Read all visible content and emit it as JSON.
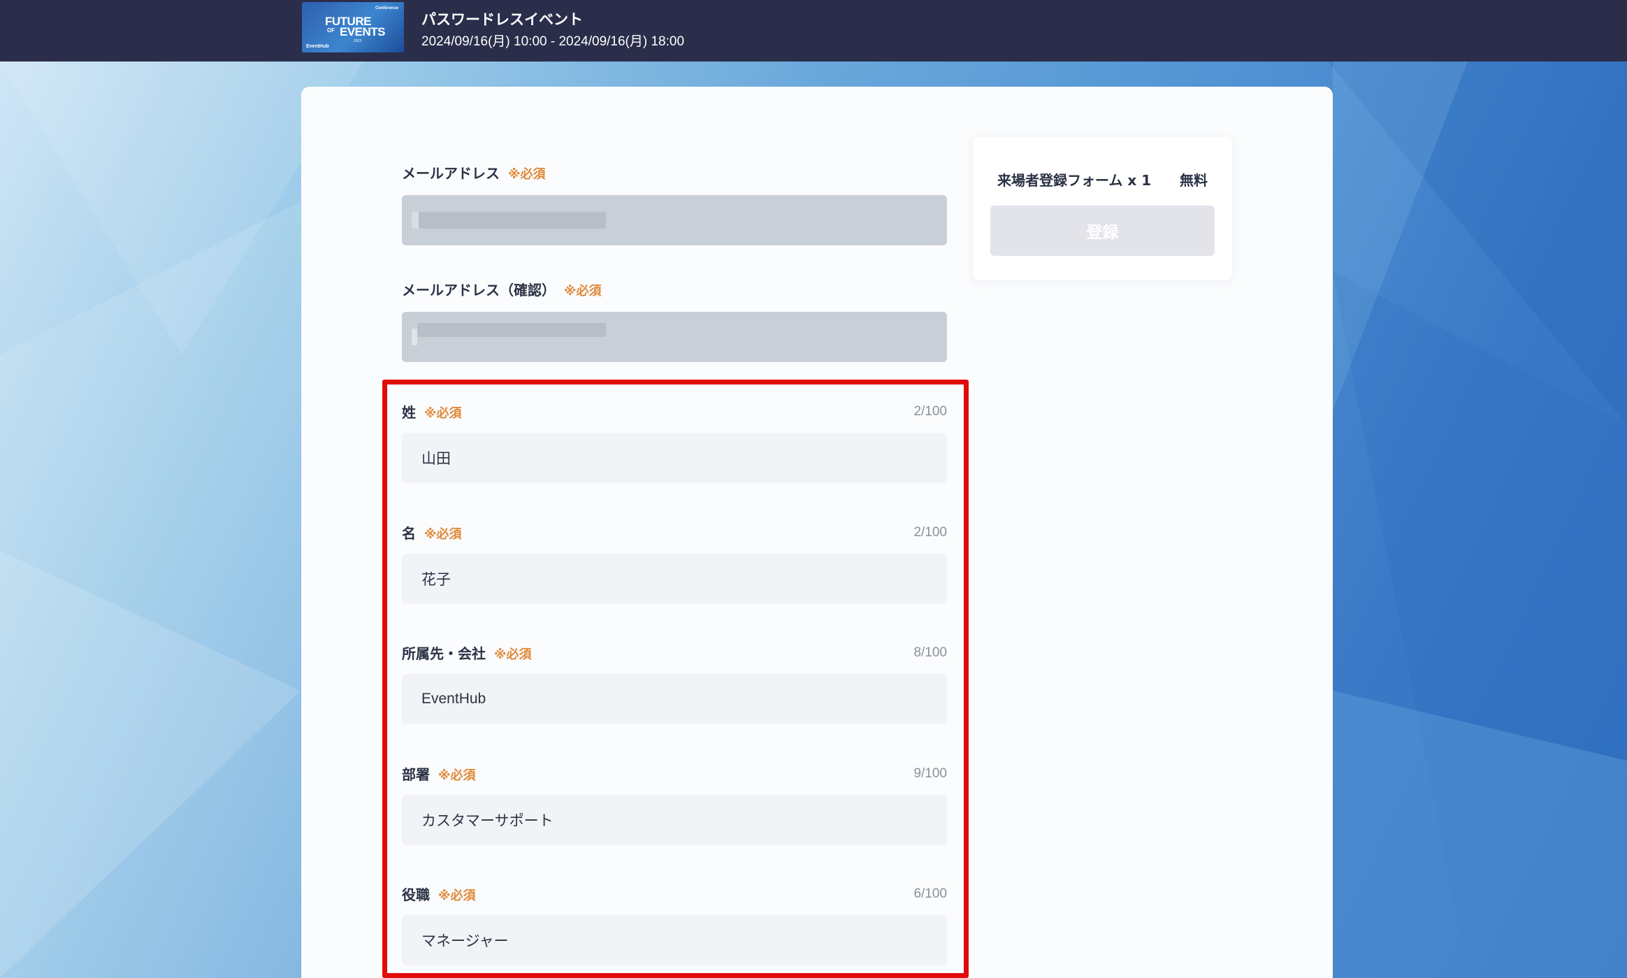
{
  "header": {
    "logo": {
      "small_text": "Conference",
      "line1": "FUTURE",
      "of": "OF",
      "line2": "EVENTS",
      "year": "2023",
      "brand": "EventHub"
    },
    "event_title": "パスワードレスイベント",
    "event_date": "2024/09/16(月) 10:00 - 2024/09/16(月) 18:00"
  },
  "form": {
    "required_mark": "※必須",
    "fields": [
      {
        "label": "メールアドレス",
        "value": "",
        "masked": true
      },
      {
        "label": "メールアドレス（確認）",
        "value": "",
        "masked": true
      },
      {
        "label": "姓",
        "value": "山田",
        "counter": "2/100"
      },
      {
        "label": "名",
        "value": "花子",
        "counter": "2/100"
      },
      {
        "label": "所属先・会社",
        "value": "EventHub",
        "counter": "8/100"
      },
      {
        "label": "部署",
        "value": "カスタマーサポート",
        "counter": "9/100"
      },
      {
        "label": "役職",
        "value": "マネージャー",
        "counter": "6/100"
      }
    ]
  },
  "summary": {
    "ticket": "来場者登録フォーム x 1",
    "price": "無料",
    "register_label": "登録"
  },
  "colors": {
    "header_bg": "#2b2e4a",
    "required": "#e08a3c",
    "highlight": "#e00b0b",
    "input_bg": "#f2f3f6"
  }
}
